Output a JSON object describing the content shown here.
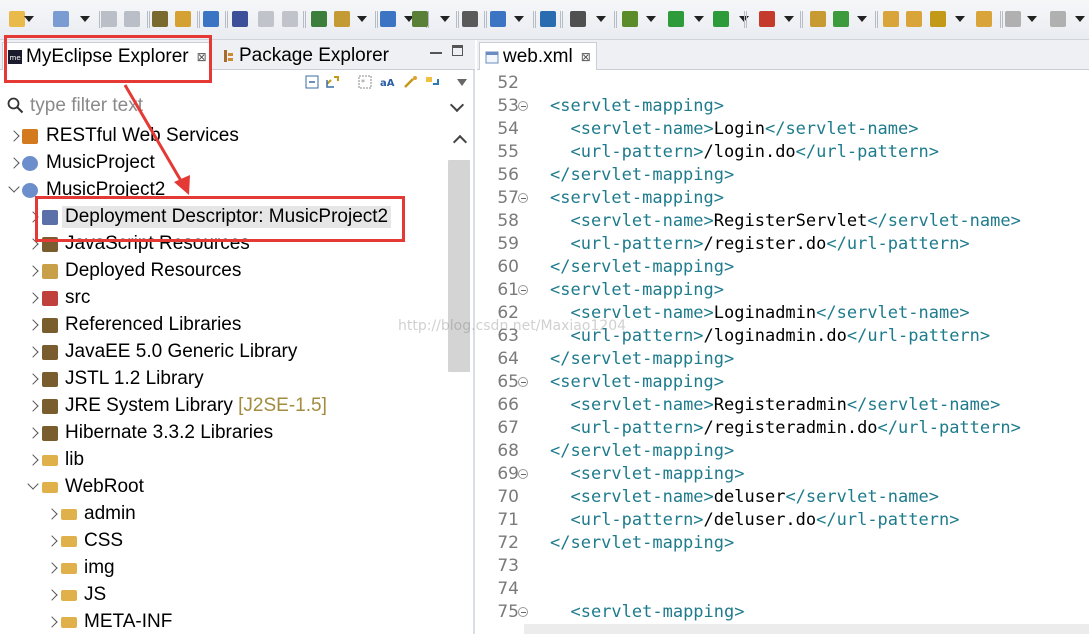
{
  "left_panel": {
    "tabs": [
      {
        "label": "MyEclipse Explorer",
        "close": "⊠",
        "icon": "myeclipse-icon"
      },
      {
        "label": "Package Explorer",
        "icon": "package-explorer-icon"
      }
    ],
    "filter": {
      "placeholder": "type filter text"
    },
    "tree": [
      {
        "label": "RESTful Web Services",
        "icon": "rest-services-icon",
        "expanded": false,
        "depth": 0
      },
      {
        "label": "MusicProject",
        "icon": "project-icon",
        "expanded": false,
        "depth": 0
      },
      {
        "label": "MusicProject2",
        "icon": "project-icon",
        "expanded": true,
        "depth": 0
      },
      {
        "label": "Deployment Descriptor: MusicProject2",
        "icon": "deployment-descriptor-icon",
        "expanded": false,
        "depth": 1,
        "selected": true
      },
      {
        "label": "JavaScript Resources",
        "icon": "library-icon",
        "expanded": false,
        "depth": 1
      },
      {
        "label": "Deployed Resources",
        "icon": "deployed-icon",
        "expanded": false,
        "depth": 1
      },
      {
        "label": "src",
        "icon": "source-folder-icon",
        "expanded": false,
        "depth": 1
      },
      {
        "label": "Referenced Libraries",
        "icon": "library-icon",
        "expanded": false,
        "depth": 1
      },
      {
        "label": "JavaEE 5.0 Generic Library",
        "icon": "library-icon",
        "expanded": false,
        "depth": 1
      },
      {
        "label": "JSTL 1.2 Library",
        "icon": "library-icon",
        "expanded": false,
        "depth": 1
      },
      {
        "label": "JRE System Library",
        "suffix": "[J2SE-1.5]",
        "icon": "library-icon",
        "expanded": false,
        "depth": 1
      },
      {
        "label": "Hibernate 3.3.2 Libraries",
        "icon": "library-icon",
        "expanded": false,
        "depth": 1
      },
      {
        "label": "lib",
        "icon": "folder-icon",
        "expanded": false,
        "depth": 1
      },
      {
        "label": "WebRoot",
        "icon": "folder-open-icon",
        "expanded": true,
        "depth": 1
      },
      {
        "label": "admin",
        "icon": "folder-icon",
        "expanded": false,
        "depth": 2
      },
      {
        "label": "CSS",
        "icon": "folder-icon",
        "expanded": false,
        "depth": 2
      },
      {
        "label": "img",
        "icon": "folder-icon",
        "expanded": false,
        "depth": 2
      },
      {
        "label": "JS",
        "icon": "folder-icon",
        "expanded": false,
        "depth": 2
      },
      {
        "label": "META-INF",
        "icon": "folder-icon",
        "expanded": false,
        "depth": 2
      }
    ]
  },
  "editor": {
    "tab": {
      "label": "web.xml",
      "close": "⊠",
      "icon": "xml-file-icon"
    },
    "lines": [
      {
        "n": "52",
        "indent": "",
        "parts": []
      },
      {
        "n": "53",
        "fold": true,
        "indent": "",
        "parts": [
          [
            "tag",
            "<servlet-mapping>"
          ]
        ]
      },
      {
        "n": "54",
        "indent": "  ",
        "parts": [
          [
            "tag",
            "<servlet-name>"
          ],
          [
            "val",
            "Login"
          ],
          [
            "tag",
            "</servlet-name>"
          ]
        ]
      },
      {
        "n": "55",
        "indent": "  ",
        "parts": [
          [
            "tag",
            "<url-pattern>"
          ],
          [
            "val",
            "/login.do"
          ],
          [
            "tag",
            "</url-pattern>"
          ]
        ]
      },
      {
        "n": "56",
        "indent": "",
        "parts": [
          [
            "tag",
            "</servlet-mapping>"
          ]
        ]
      },
      {
        "n": "57",
        "fold": true,
        "indent": "",
        "parts": [
          [
            "tag",
            "<servlet-mapping>"
          ]
        ]
      },
      {
        "n": "58",
        "indent": "  ",
        "parts": [
          [
            "tag",
            "<servlet-name>"
          ],
          [
            "val",
            "RegisterServlet"
          ],
          [
            "tag",
            "</servlet-name>"
          ]
        ]
      },
      {
        "n": "59",
        "indent": "  ",
        "parts": [
          [
            "tag",
            "<url-pattern>"
          ],
          [
            "val",
            "/register.do"
          ],
          [
            "tag",
            "</url-pattern>"
          ]
        ]
      },
      {
        "n": "60",
        "indent": "",
        "parts": [
          [
            "tag",
            "</servlet-mapping>"
          ]
        ]
      },
      {
        "n": "61",
        "fold": true,
        "indent": "",
        "parts": [
          [
            "tag",
            "<servlet-mapping>"
          ]
        ]
      },
      {
        "n": "62",
        "indent": "  ",
        "parts": [
          [
            "tag",
            "<servlet-name>"
          ],
          [
            "val",
            "Loginadmin"
          ],
          [
            "tag",
            "</servlet-name>"
          ]
        ]
      },
      {
        "n": "63",
        "indent": "  ",
        "parts": [
          [
            "tag",
            "<url-pattern>"
          ],
          [
            "val",
            "/loginadmin.do"
          ],
          [
            "tag",
            "</url-pattern>"
          ]
        ]
      },
      {
        "n": "64",
        "indent": "",
        "parts": [
          [
            "tag",
            "</servlet-mapping>"
          ]
        ]
      },
      {
        "n": "65",
        "fold": true,
        "indent": "",
        "parts": [
          [
            "tag",
            "<servlet-mapping>"
          ]
        ]
      },
      {
        "n": "66",
        "indent": "  ",
        "parts": [
          [
            "tag",
            "<servlet-name>"
          ],
          [
            "val",
            "Registeradmin"
          ],
          [
            "tag",
            "</servlet-name>"
          ]
        ]
      },
      {
        "n": "67",
        "indent": "  ",
        "parts": [
          [
            "tag",
            "<url-pattern>"
          ],
          [
            "val",
            "/registeradmin.do"
          ],
          [
            "tag",
            "</url-pattern>"
          ]
        ]
      },
      {
        "n": "68",
        "indent": "",
        "parts": [
          [
            "tag",
            "</servlet-mapping>"
          ]
        ]
      },
      {
        "n": "69",
        "fold": true,
        "indent": "  ",
        "parts": [
          [
            "tag",
            "<servlet-mapping>"
          ]
        ]
      },
      {
        "n": "70",
        "indent": "  ",
        "parts": [
          [
            "tag",
            "<servlet-name>"
          ],
          [
            "val",
            "deluser"
          ],
          [
            "tag",
            "</servlet-name>"
          ]
        ]
      },
      {
        "n": "71",
        "indent": "  ",
        "parts": [
          [
            "tag",
            "<url-pattern>"
          ],
          [
            "val",
            "/deluser.do"
          ],
          [
            "tag",
            "</url-pattern>"
          ]
        ]
      },
      {
        "n": "72",
        "indent": "",
        "parts": [
          [
            "tag",
            "</servlet-mapping>"
          ]
        ]
      },
      {
        "n": "73",
        "indent": "",
        "parts": []
      },
      {
        "n": "74",
        "indent": "",
        "parts": []
      },
      {
        "n": "75",
        "fold": true,
        "indent": "  ",
        "parts": [
          [
            "tag",
            "<servlet-mapping>"
          ]
        ]
      }
    ]
  },
  "watermark": "http://blog.csdn.net/Maxiao1204",
  "colors": {
    "tag": "#1e7b8c",
    "annotation": "#e53935",
    "suffix": "#a38b3f"
  }
}
